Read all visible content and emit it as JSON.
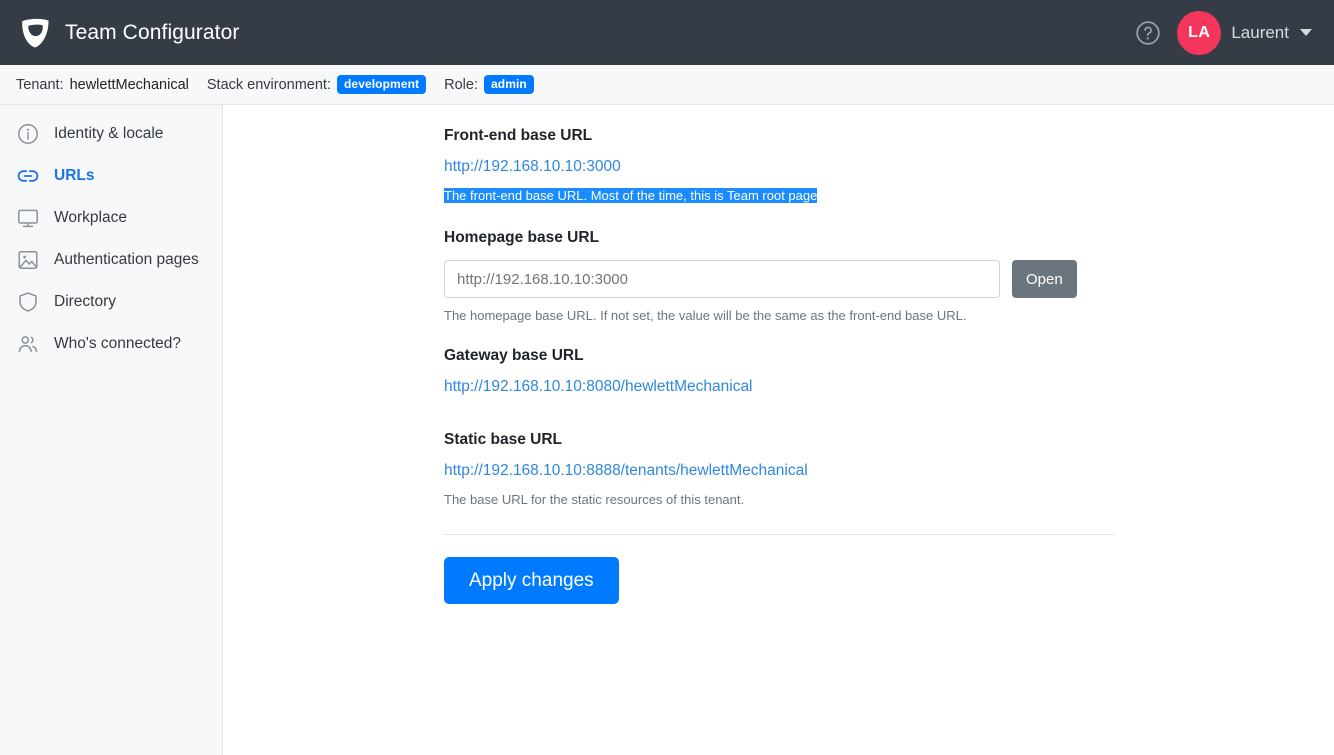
{
  "header": {
    "brand_title": "Team Configurator",
    "logo_icon": "shield-leaf-logo",
    "help_icon": "question-circle-icon",
    "avatar_initials": "LA",
    "user_name": "Laurent",
    "caret_icon": "chevron-down-icon",
    "background_color": "#363c45",
    "avatar_color": "#f5365c"
  },
  "context_bar": {
    "tenant_label": "Tenant:",
    "tenant_value": "hewlettMechanical",
    "stack_label": "Stack environment:",
    "stack_value": "development",
    "role_label": "Role:",
    "role_value": "admin",
    "badge_color": "#007bff"
  },
  "sidebar": {
    "items": [
      {
        "label": "Identity & locale",
        "icon": "info-circle-icon",
        "active": false
      },
      {
        "label": "URLs",
        "icon": "link-icon",
        "active": true
      },
      {
        "label": "Workplace",
        "icon": "monitor-icon",
        "active": false
      },
      {
        "label": "Authentication pages",
        "icon": "image-icon",
        "active": false
      },
      {
        "label": "Directory",
        "icon": "shield-icon",
        "active": false
      },
      {
        "label": "Who's connected?",
        "icon": "users-icon",
        "active": false
      }
    ],
    "active_color": "#1a73e8"
  },
  "main": {
    "frontend": {
      "label": "Front-end base URL",
      "url": "http://192.168.10.10:3000",
      "help": "The front-end base URL. Most of the time, this is Team root page",
      "help_selected": true,
      "selection_color": "#1a8cff"
    },
    "homepage": {
      "label": "Homepage base URL",
      "input_value": "",
      "input_placeholder": "http://192.168.10.10:3000",
      "open_button": "Open",
      "help": "The homepage base URL. If not set, the value will be the same as the front-end base URL."
    },
    "gateway": {
      "label": "Gateway base URL",
      "url": "http://192.168.10.10:8080/hewlettMechanical"
    },
    "static": {
      "label": "Static base URL",
      "url": "http://192.168.10.10:8888/tenants/hewlettMechanical",
      "help": "The base URL for the static resources of this tenant."
    },
    "apply_button": "Apply changes",
    "link_color": "#2f87e0",
    "primary_color": "#007bff"
  }
}
